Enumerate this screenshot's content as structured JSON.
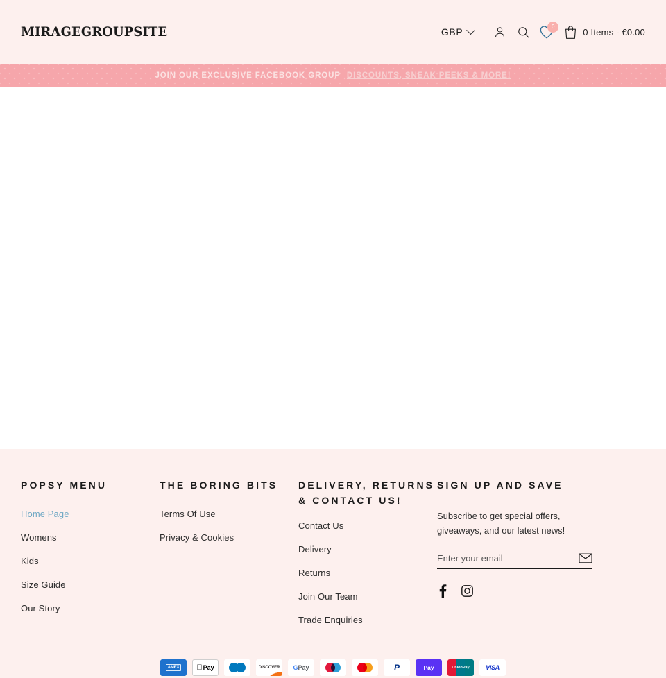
{
  "header": {
    "logo": "MIRAGEGROUPSITE",
    "currency": "GBP",
    "account_icon": "user-icon",
    "search_icon": "search-icon",
    "wishlist_icon": "heart-icon",
    "wishlist_badge": "0",
    "cart_icon": "shopping-bag-icon",
    "cart_text": "0 Items - €0.00"
  },
  "announcement": {
    "text": "JOIN OUR EXCLUSIVE FACEBOOK GROUP",
    "link": "DISCOUNTS, SNEAK PEEKS & MORE!"
  },
  "footer": {
    "columns": [
      {
        "title": "POPSY MENU",
        "links": [
          {
            "label": "Home Page",
            "active": true
          },
          {
            "label": "Womens",
            "active": false
          },
          {
            "label": "Kids",
            "active": false
          },
          {
            "label": "Size Guide",
            "active": false
          },
          {
            "label": "Our Story",
            "active": false
          }
        ]
      },
      {
        "title": "THE BORING BITS",
        "links": [
          {
            "label": "Terms Of Use",
            "active": false
          },
          {
            "label": "Privacy & Cookies",
            "active": false
          }
        ]
      },
      {
        "title": "DELIVERY, RETURNS & CONTACT US!",
        "links": [
          {
            "label": "Contact Us",
            "active": false
          },
          {
            "label": "Delivery",
            "active": false
          },
          {
            "label": "Returns",
            "active": false
          },
          {
            "label": "Join Our Team",
            "active": false
          },
          {
            "label": "Trade Enquiries",
            "active": false
          }
        ]
      }
    ],
    "newsletter": {
      "title": "SIGN UP AND SAVE",
      "description": "Subscribe to get special offers, giveaways, and our latest news!",
      "placeholder": "Enter your email",
      "value": "",
      "submit_icon": "envelope-icon"
    },
    "socials": [
      {
        "name": "facebook-icon",
        "label": "Facebook"
      },
      {
        "name": "instagram-icon",
        "label": "Instagram"
      }
    ],
    "payments": [
      {
        "name": "american-express",
        "label": "AMEX"
      },
      {
        "name": "apple-pay",
        "label": "Pay"
      },
      {
        "name": "diners-club",
        "label": "Diners Club"
      },
      {
        "name": "discover",
        "label": "DISCOVER"
      },
      {
        "name": "google-pay",
        "label": "Pay"
      },
      {
        "name": "maestro",
        "label": "Maestro"
      },
      {
        "name": "mastercard",
        "label": "Mastercard"
      },
      {
        "name": "paypal",
        "label": "P"
      },
      {
        "name": "shop-pay",
        "label": "Pay"
      },
      {
        "name": "union-pay",
        "label": "UnionPay"
      },
      {
        "name": "visa",
        "label": "VISA"
      }
    ]
  },
  "colors": {
    "header_bg": "#fdf0ee",
    "announcement_bg": "#f6a6ab",
    "footer_bg": "#fdf0ee",
    "body_bg": "#ffffff",
    "accent_link": "#6fa8c4",
    "wishlist_badge": "#f9b0ac"
  }
}
